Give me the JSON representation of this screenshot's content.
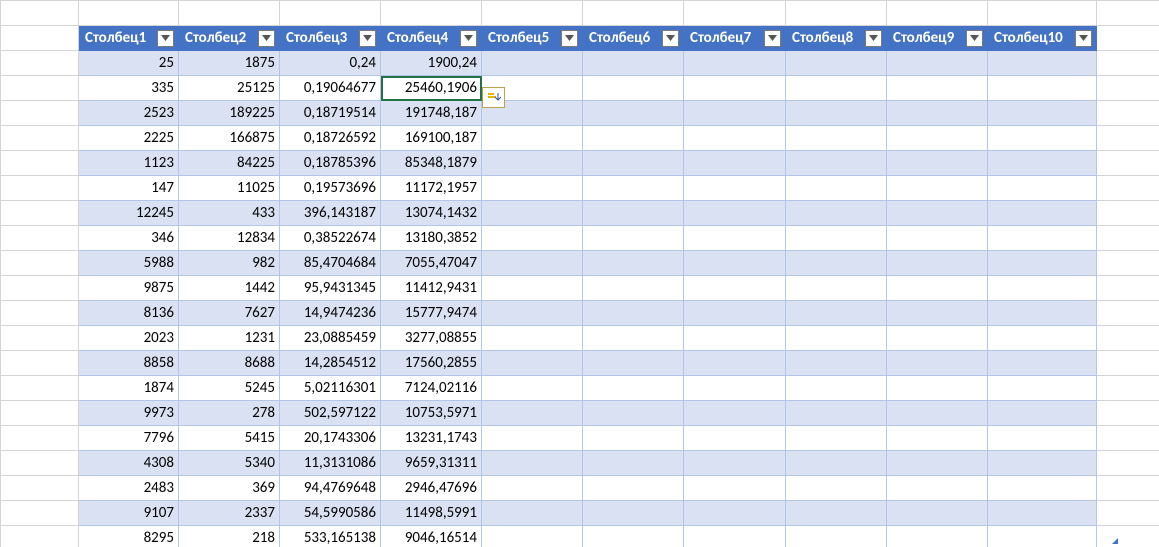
{
  "headers": [
    "Столбец1",
    "Столбец2",
    "Столбец3",
    "Столбец4",
    "Столбец5",
    "Столбец6",
    "Столбец7",
    "Столбец8",
    "Столбец9",
    "Столбец10"
  ],
  "rows": [
    {
      "c0": "25",
      "c1": "1875",
      "c2": "0,24",
      "c3": "1900,24"
    },
    {
      "c0": "335",
      "c1": "25125",
      "c2": "0,19064677",
      "c3": "25460,1906"
    },
    {
      "c0": "2523",
      "c1": "189225",
      "c2": "0,18719514",
      "c3": "191748,187"
    },
    {
      "c0": "2225",
      "c1": "166875",
      "c2": "0,18726592",
      "c3": "169100,187"
    },
    {
      "c0": "1123",
      "c1": "84225",
      "c2": "0,18785396",
      "c3": "85348,1879"
    },
    {
      "c0": "147",
      "c1": "11025",
      "c2": "0,19573696",
      "c3": "11172,1957"
    },
    {
      "c0": "12245",
      "c1": "433",
      "c2": "396,143187",
      "c3": "13074,1432"
    },
    {
      "c0": "346",
      "c1": "12834",
      "c2": "0,38522674",
      "c3": "13180,3852"
    },
    {
      "c0": "5988",
      "c1": "982",
      "c2": "85,4704684",
      "c3": "7055,47047"
    },
    {
      "c0": "9875",
      "c1": "1442",
      "c2": "95,9431345",
      "c3": "11412,9431"
    },
    {
      "c0": "8136",
      "c1": "7627",
      "c2": "14,9474236",
      "c3": "15777,9474"
    },
    {
      "c0": "2023",
      "c1": "1231",
      "c2": "23,0885459",
      "c3": "3277,08855"
    },
    {
      "c0": "8858",
      "c1": "8688",
      "c2": "14,2854512",
      "c3": "17560,2855"
    },
    {
      "c0": "1874",
      "c1": "5245",
      "c2": "5,02116301",
      "c3": "7124,02116"
    },
    {
      "c0": "9973",
      "c1": "278",
      "c2": "502,597122",
      "c3": "10753,5971"
    },
    {
      "c0": "7796",
      "c1": "5415",
      "c2": "20,1743306",
      "c3": "13231,1743"
    },
    {
      "c0": "4308",
      "c1": "5340",
      "c2": "11,3131086",
      "c3": "9659,31311"
    },
    {
      "c0": "2483",
      "c1": "369",
      "c2": "94,4769648",
      "c3": "2946,47696"
    },
    {
      "c0": "9107",
      "c1": "2337",
      "c2": "54,5990586",
      "c3": "11498,5991"
    },
    {
      "c0": "8295",
      "c1": "218",
      "c2": "533,165138",
      "c3": "9046,16514"
    }
  ],
  "active": {
    "row": 1,
    "col": 3
  }
}
